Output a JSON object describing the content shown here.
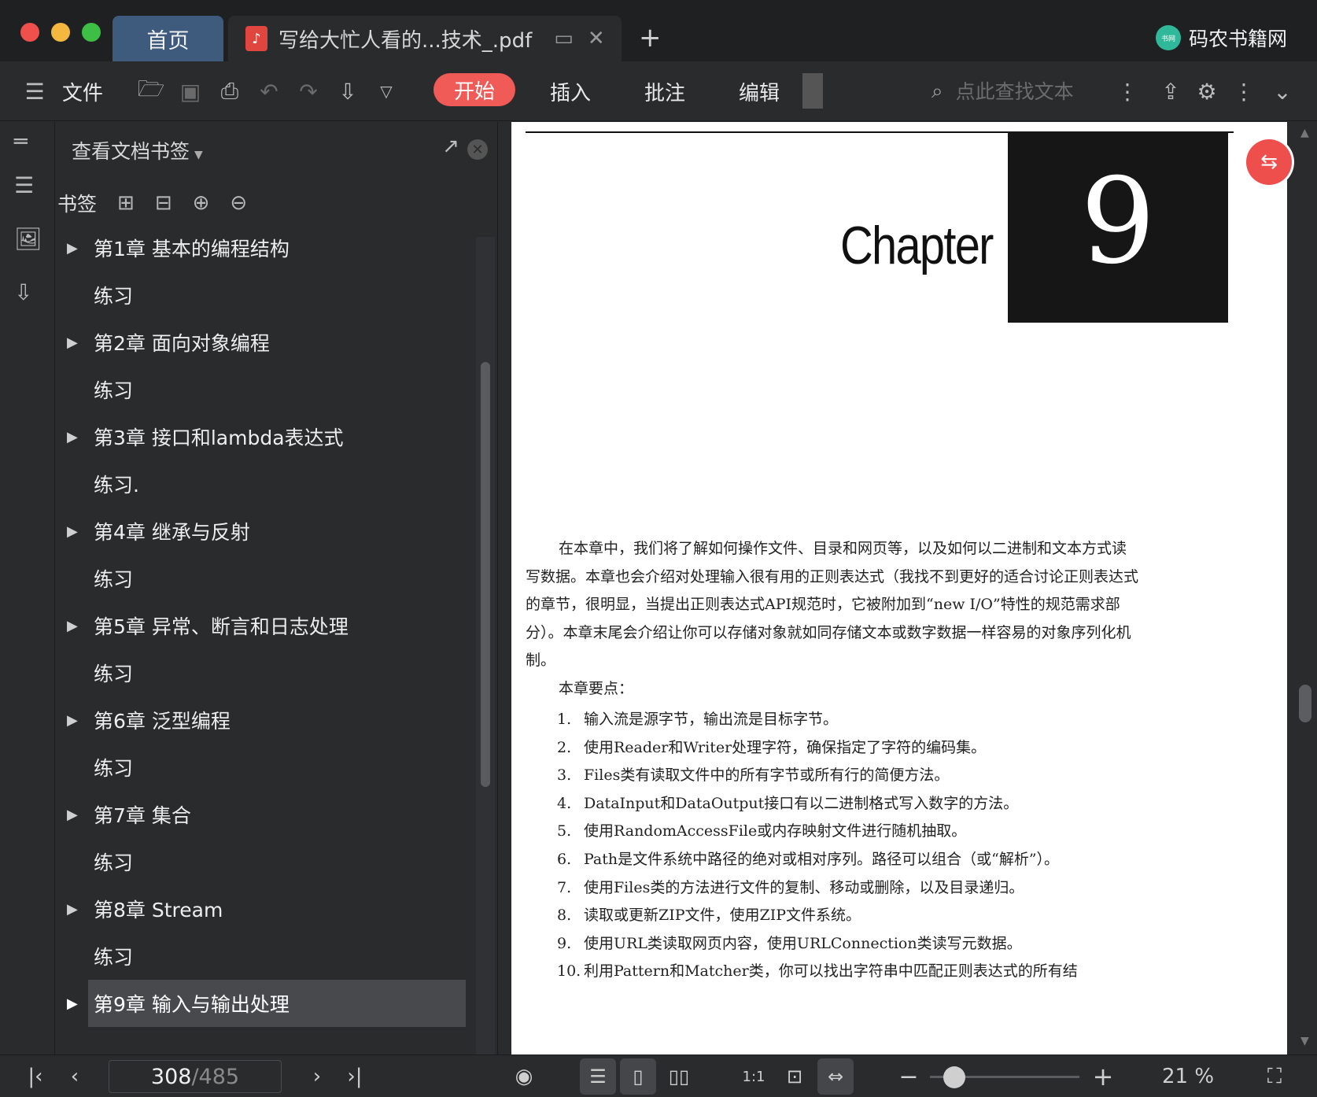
{
  "titlebar": {
    "home_tab": "首页",
    "doc_tab": "写给大忙人看的...技术_.pdf",
    "pdf_icon": "♪",
    "brand_name": "码农书籍网",
    "brand_logo_text": "书网",
    "colors": {
      "close": "#f0504b",
      "minimize": "#f4b73f",
      "maximize": "#3cbf44"
    }
  },
  "toolbar": {
    "file_label": "文件",
    "start_label": "开始",
    "insert_label": "插入",
    "annotate_label": "批注",
    "edit_label": "编辑",
    "search_placeholder": "点此查找文本"
  },
  "panel": {
    "header": "查看文档书签",
    "bookmarks_label": "书签",
    "toc": [
      {
        "label": "第1章 基本的编程结构",
        "expandable": true
      },
      {
        "label": "练习",
        "expandable": false
      },
      {
        "label": "第2章 面向对象编程",
        "expandable": true
      },
      {
        "label": "练习",
        "expandable": false
      },
      {
        "label": "第3章 接口和lambda表达式",
        "expandable": true
      },
      {
        "label": "练习.",
        "expandable": false
      },
      {
        "label": "第4章 继承与反射",
        "expandable": true
      },
      {
        "label": "练习",
        "expandable": false
      },
      {
        "label": "第5章 异常、断言和日志处理",
        "expandable": true
      },
      {
        "label": "练习",
        "expandable": false
      },
      {
        "label": "第6章 泛型编程",
        "expandable": true
      },
      {
        "label": "练习",
        "expandable": false
      },
      {
        "label": "第7章 集合",
        "expandable": true
      },
      {
        "label": "练习",
        "expandable": false
      },
      {
        "label": "第8章 Stream",
        "expandable": true
      },
      {
        "label": "练习",
        "expandable": false
      },
      {
        "label": "第9章 输入与输出处理",
        "expandable": true,
        "active": true
      }
    ]
  },
  "document": {
    "chapter_word": "Chapter",
    "chapter_number": "9",
    "intro": "在本章中，我们将了解如何操作文件、目录和网页等，以及如何以二进制和文本方式读写数据。本章也会介绍对处理输入很有用的正则表达式（我找不到更好的适合讨论正则表达式的章节，很明显，当提出正则表达式API规范时，它被附加到“new I/O”特性的规范需求部分）。本章末尾会介绍让你可以存储对象就如同存储文本或数字数据一样容易的对象序列化机制。",
    "points_heading": "本章要点：",
    "points": [
      {
        "n": "1.",
        "text": "输入流是源字节，输出流是目标字节。"
      },
      {
        "n": "2.",
        "text": "使用Reader和Writer处理字符，确保指定了字符的编码集。"
      },
      {
        "n": "3.",
        "text": "Files类有读取文件中的所有字节或所有行的简便方法。"
      },
      {
        "n": "4.",
        "text": "DataInput和DataOutput接口有以二进制格式写入数字的方法。"
      },
      {
        "n": "5.",
        "text": "使用RandomAccessFile或内存映射文件进行随机抽取。"
      },
      {
        "n": "6.",
        "text": "Path是文件系统中路径的绝对或相对序列。路径可以组合（或“解析”）。"
      },
      {
        "n": "7.",
        "text": "使用Files类的方法进行文件的复制、移动或删除，以及目录递归。"
      },
      {
        "n": "8.",
        "text": "读取或更新ZIP文件，使用ZIP文件系统。"
      },
      {
        "n": "9.",
        "text": "使用URL类读取网页内容，使用URLConnection类读写元数据。"
      },
      {
        "n": "10.",
        "text": "利用Pattern和Matcher类，你可以找出字符串中匹配正则表达式的所有结"
      }
    ]
  },
  "statusbar": {
    "current_page": "308",
    "separator": "/",
    "total_pages": "485",
    "zoom": "21 %",
    "zoom_level": 0.21
  },
  "accent_color": "#f05a57"
}
